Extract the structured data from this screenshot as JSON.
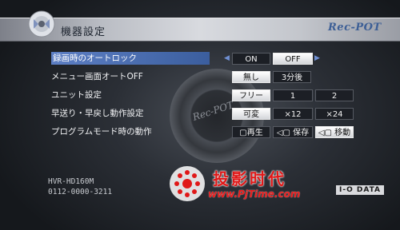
{
  "header": {
    "title": "機器設定",
    "brand": "Rec-POT"
  },
  "background": {
    "disc_label": "Rec-POT"
  },
  "settings": [
    {
      "label": "録画時のオートロック",
      "options": [
        "ON",
        "OFF"
      ],
      "selected": "OFF",
      "has_arrows": true
    },
    {
      "label": "メニュー画面オートOFF",
      "options": [
        "無し",
        "3分後"
      ],
      "selected": "無し"
    },
    {
      "label": "ユニット設定",
      "options": [
        "フリー",
        "1",
        "2"
      ],
      "selected": "フリー"
    },
    {
      "label": "早送り・早戻し動作設定",
      "options": [
        "可変",
        "×12",
        "×24"
      ],
      "selected": "可変"
    },
    {
      "label": "プログラムモード時の動作",
      "options": [
        "▢再生",
        "◁▢ 保存",
        "◁▢ 移動"
      ],
      "selected": "◁▢ 移動"
    }
  ],
  "device": {
    "model": "HVR-HD160M",
    "serial": "0112-0000-3211"
  },
  "watermark": {
    "title": "投影时代",
    "url": "www.PjTime.com"
  },
  "maker_logo": "I-O DATA",
  "colors": {
    "highlight": "#5d7fc4",
    "selected_option": "#ffffff",
    "watermark": "#e01818"
  }
}
